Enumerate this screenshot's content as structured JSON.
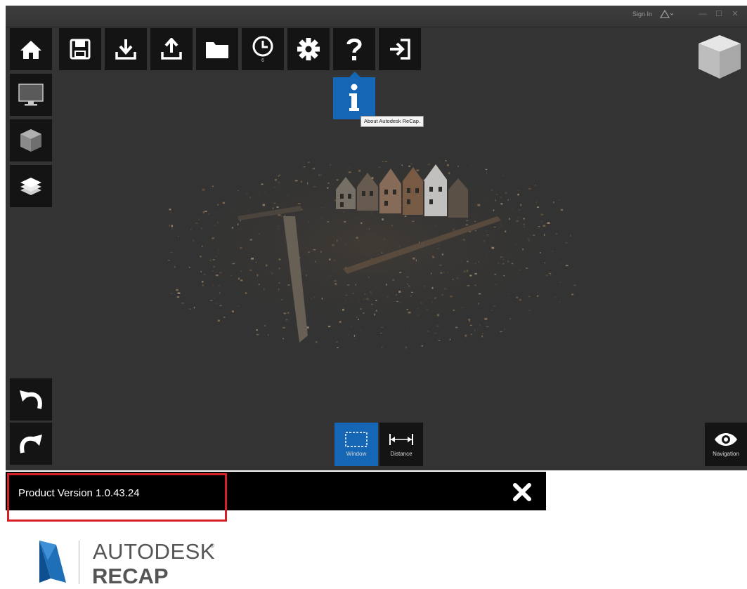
{
  "window": {
    "sign_in": "Sign In",
    "minimize": "—",
    "maximize": "☐",
    "close": "✕"
  },
  "toolbar": {
    "items": [
      {
        "name": "home",
        "icon": "home-icon"
      },
      {
        "name": "save",
        "icon": "save-icon"
      },
      {
        "name": "import",
        "icon": "download-icon"
      },
      {
        "name": "export",
        "icon": "upload-icon"
      },
      {
        "name": "open",
        "icon": "folder-icon"
      },
      {
        "name": "history",
        "icon": "clock-icon"
      },
      {
        "name": "settings",
        "icon": "gear-icon"
      },
      {
        "name": "help",
        "icon": "question-icon"
      },
      {
        "name": "sign-out",
        "icon": "exit-icon"
      }
    ],
    "history_badge": "6"
  },
  "help_popup": {
    "info_icon": "info-icon",
    "tooltip": "About Autodesk ReCap."
  },
  "side_tools": [
    {
      "name": "display",
      "icon": "monitor-icon"
    },
    {
      "name": "view-cube",
      "icon": "cube-icon"
    },
    {
      "name": "layers",
      "icon": "layers-icon"
    }
  ],
  "bottom_tools": {
    "window_label": "Window",
    "distance_label": "Distance",
    "navigation_label": "Navigation"
  },
  "version_bar": {
    "text": "Product Version 1.0.43.24"
  },
  "brand": {
    "line1": "AUTODESK",
    "reg": "®",
    "line2": "RECAP"
  },
  "colors": {
    "viewport": "#333333",
    "toolbar_tile": "#141414",
    "accent_blue": "#1566b5",
    "highlight_red": "#d61f26"
  }
}
